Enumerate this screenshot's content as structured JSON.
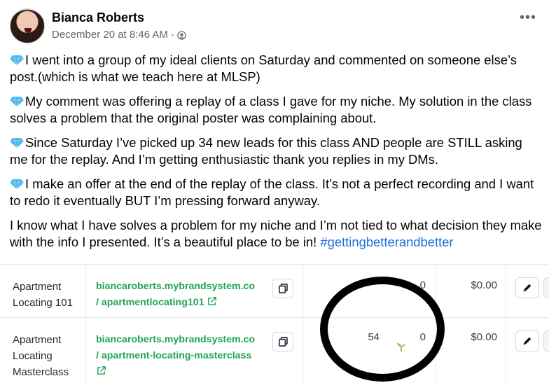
{
  "post": {
    "author": "Bianca Roberts",
    "timestamp": "December 20 at 8:46 AM",
    "separator": "·",
    "privacy_icon": "globe-icon",
    "more_icon": "more-dots-icon",
    "paragraphs": [
      {
        "icon": "gem-icon",
        "text": "I went into a group of my ideal clients on Saturday and commented on someone else’s post.(which is what we teach here at MLSP)"
      },
      {
        "icon": "gem-icon",
        "text": "My comment was offering a replay of a class I gave for my niche. My solution in the class solves a problem that the original poster was complaining about."
      },
      {
        "icon": "gem-icon",
        "text": "Since Saturday I’ve picked up 34 new leads for this class AND people are STILL asking me for the replay. And I’m getting enthusiastic thank you replies in my DMs."
      },
      {
        "icon": "gem-icon",
        "text": "I make an offer at the end of the replay of the class. It’s not a perfect recording and I want to redo it eventually BUT I’m pressing forward anyway."
      }
    ],
    "closing_text": "I know what I have solves a problem for my niche and I’m not tied to what decision they make with the info I presented. It’s a beautiful place to be in! ",
    "hashtag": "#gettingbetterandbetter"
  },
  "table": {
    "rows": [
      {
        "name_lines": [
          "Apartment",
          "Locating 101"
        ],
        "link_line1": "biancaroberts.mybrandsystem.co",
        "link_line2": "/ apartmentlocating101",
        "count_a": "",
        "count_b": "0",
        "price": "$0.00"
      },
      {
        "name_lines": [
          "Apartment",
          "Locating",
          "Masterclass"
        ],
        "link_line1": "biancaroberts.mybrandsystem.co",
        "link_line2": "/ apartment-locating-masterclass",
        "count_a": "54",
        "count_b": "0",
        "price": "$0.00"
      }
    ]
  },
  "colors": {
    "link_green": "#22a35a",
    "hashtag_blue": "#216fdb",
    "meta_gray": "#65676b",
    "gem_blue": "#4fb3e8"
  }
}
